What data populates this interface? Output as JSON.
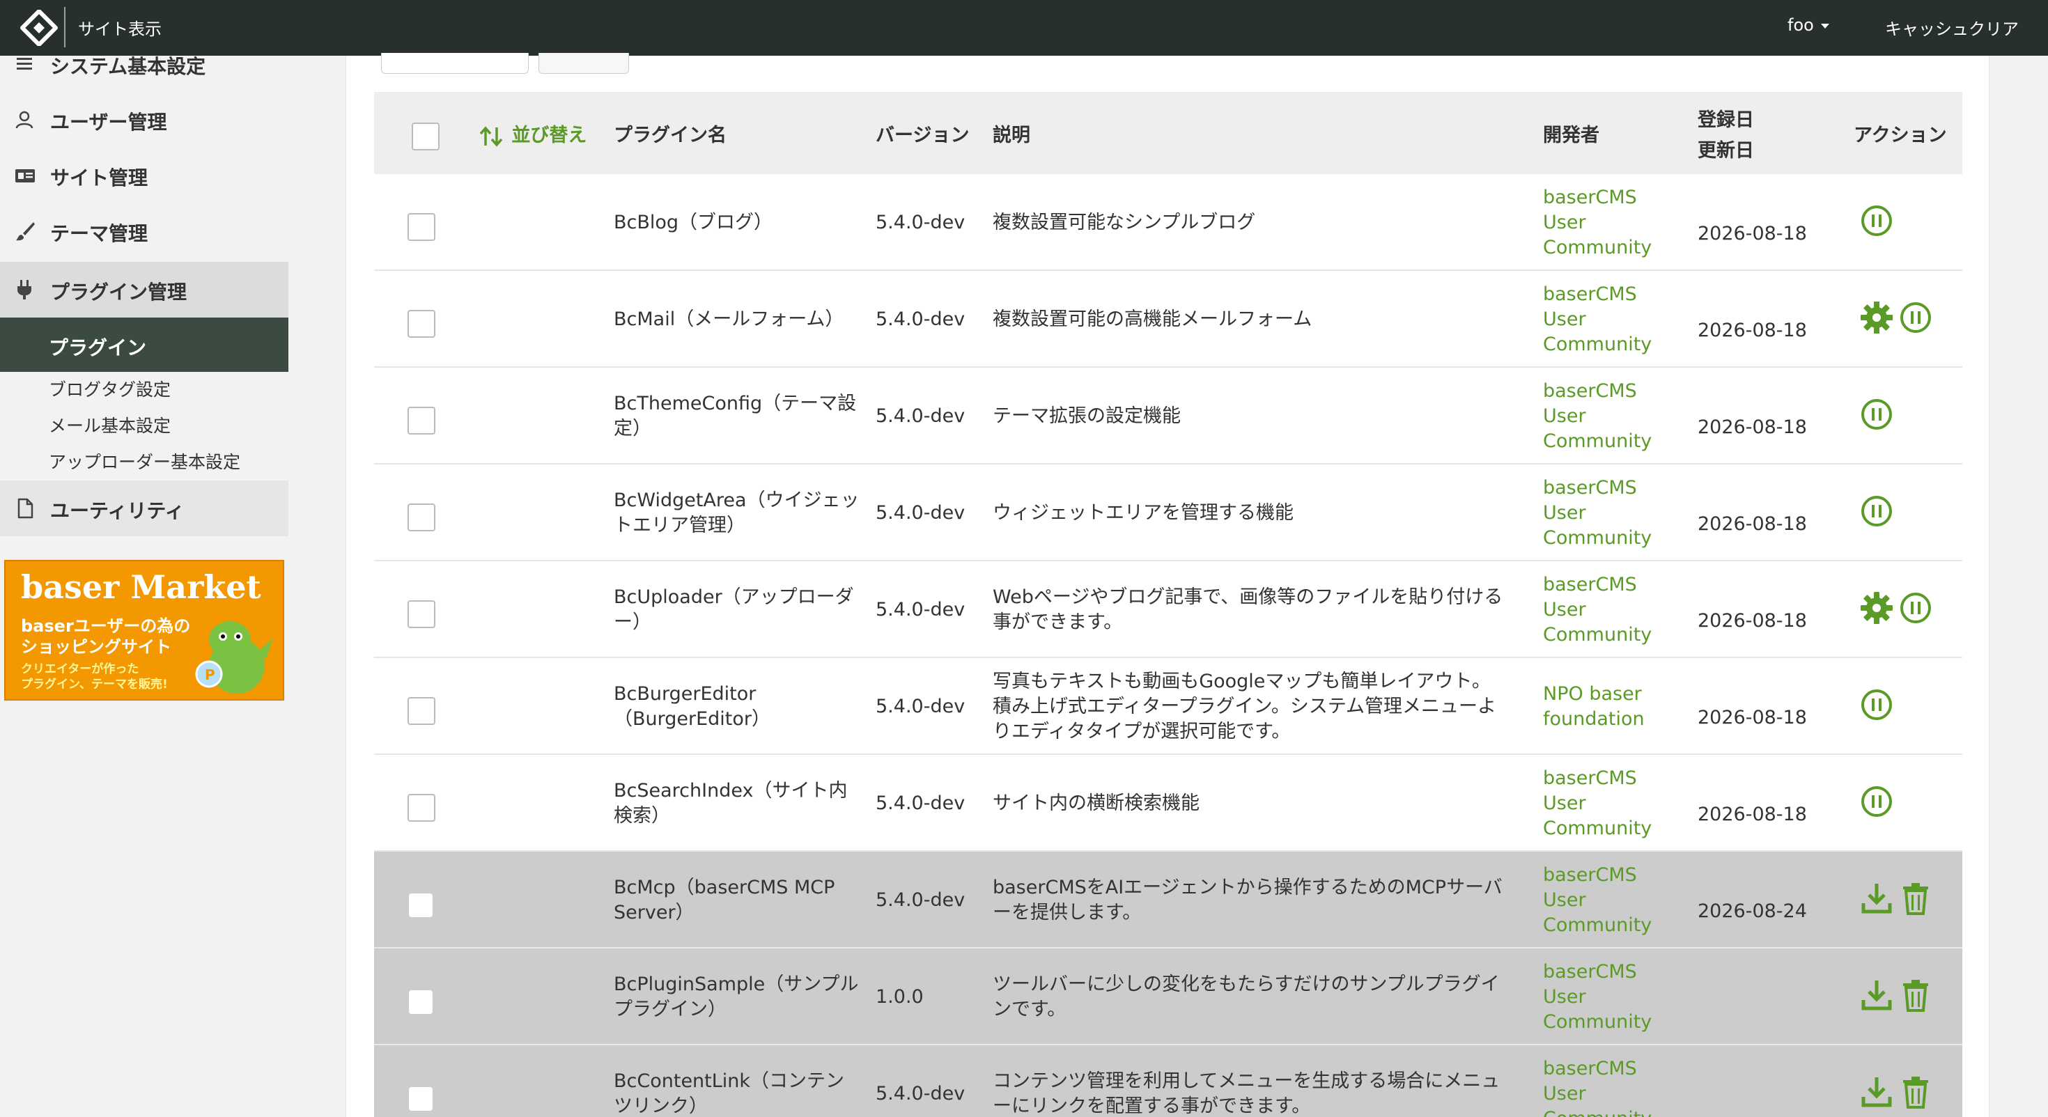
{
  "header": {
    "site_link": "サイト表示",
    "user": "foo",
    "cache_clear": "キャッシュクリア"
  },
  "sidebar": {
    "items": [
      {
        "label": "システム基本設定",
        "icon": "menu-icon"
      },
      {
        "label": "ユーザー管理",
        "icon": "user-icon"
      },
      {
        "label": "サイト管理",
        "icon": "id-card-icon"
      },
      {
        "label": "テーマ管理",
        "icon": "brush-icon"
      },
      {
        "label": "プラグイン管理",
        "icon": "plug-icon"
      }
    ],
    "active_sub": "プラグイン",
    "sub_items": [
      "ブログタグ設定",
      "メール基本設定",
      "アップローダー基本設定"
    ],
    "utility": {
      "label": "ユーティリティ",
      "icon": "file-icon"
    }
  },
  "banner": {
    "title": "baser Market",
    "line1": "baserユーザーの為の",
    "line2": "ショッピングサイト",
    "line3": "クリエイターが作った",
    "line4": "プラグイン、テーマを販売!"
  },
  "table": {
    "headers": {
      "sort": "並び替え",
      "name": "プラグイン名",
      "version": "バージョン",
      "description": "説明",
      "developer": "開発者",
      "created": "登録日",
      "updated": "更新日",
      "action": "アクション"
    },
    "rows": [
      {
        "name": [
          "BcBlog（ブログ）"
        ],
        "version": "5.4.0-dev",
        "desc": [
          "複数設置可能なシンプルブログ"
        ],
        "developer": [
          "baserCMS",
          "User",
          "Community"
        ],
        "date": "2026-08-18",
        "installed": true,
        "settings": false
      },
      {
        "name": [
          "BcMail（メールフォーム）"
        ],
        "version": "5.4.0-dev",
        "desc": [
          "複数設置可能の高機能メールフォーム"
        ],
        "developer": [
          "baserCMS",
          "User",
          "Community"
        ],
        "date": "2026-08-18",
        "installed": true,
        "settings": true
      },
      {
        "name": [
          "BcThemeConfig（テーマ設",
          "定）"
        ],
        "version": "5.4.0-dev",
        "desc": [
          "テーマ拡張の設定機能"
        ],
        "developer": [
          "baserCMS",
          "User",
          "Community"
        ],
        "date": "2026-08-18",
        "installed": true,
        "settings": false
      },
      {
        "name": [
          "BcWidgetArea（ウイジェッ",
          "トエリア管理）"
        ],
        "version": "5.4.0-dev",
        "desc": [
          "ウィジェットエリアを管理する機能"
        ],
        "developer": [
          "baserCMS",
          "User",
          "Community"
        ],
        "date": "2026-08-18",
        "installed": true,
        "settings": false
      },
      {
        "name": [
          "BcUploader（アップローダ",
          "ー）"
        ],
        "version": "5.4.0-dev",
        "desc": [
          "Webページやブログ記事で、画像等のファイルを貼り付ける",
          "事ができます。"
        ],
        "developer": [
          "baserCMS",
          "User",
          "Community"
        ],
        "date": "2026-08-18",
        "installed": true,
        "settings": true
      },
      {
        "name": [
          "BcBurgerEditor",
          "（BurgerEditor）"
        ],
        "version": "5.4.0-dev",
        "desc": [
          "写真もテキストも動画もGoogleマップも簡単レイアウト。",
          "積み上げ式エディタープラグイン。システム管理メニューよ",
          "りエディタタイプが選択可能です。"
        ],
        "developer": [
          "NPO baser",
          "foundation"
        ],
        "date": "2026-08-18",
        "installed": true,
        "settings": false
      },
      {
        "name": [
          "BcSearchIndex（サイト内",
          "検索）"
        ],
        "version": "5.4.0-dev",
        "desc": [
          "サイト内の横断検索機能"
        ],
        "developer": [
          "baserCMS",
          "User",
          "Community"
        ],
        "date": "2026-08-18",
        "installed": true,
        "settings": false
      },
      {
        "name": [
          "BcMcp（baserCMS MCP",
          "Server）"
        ],
        "version": "5.4.0-dev",
        "desc": [
          "baserCMSをAIエージェントから操作するためのMCPサーバ",
          "ーを提供します。"
        ],
        "developer": [
          "baserCMS",
          "User",
          "Community"
        ],
        "date": "2026-08-24",
        "installed": false,
        "settings": false
      },
      {
        "name": [
          "BcPluginSample（サンプル",
          "プラグイン）"
        ],
        "version": "1.0.0",
        "desc": [
          "ツールバーに少しの変化をもたらすだけのサンプルプラグイ",
          "ンです。"
        ],
        "developer": [
          "baserCMS",
          "User",
          "Community"
        ],
        "date": "",
        "installed": false,
        "settings": false
      },
      {
        "name": [
          "BcContentLink（コンテン",
          "ツリンク）"
        ],
        "version": "5.4.0-dev",
        "desc": [
          "コンテンツ管理を利用してメニューを生成する場合にメニュ",
          "ーにリンクを配置する事ができます。"
        ],
        "developer": [
          "baserCMS",
          "User",
          "Community"
        ],
        "date": "",
        "installed": false,
        "settings": false
      }
    ]
  },
  "colors": {
    "topbar": "#27302b",
    "accent_green": "#5a9a26",
    "sidebar_active": "#3b4b41",
    "disabled_row": "#cccccc"
  }
}
